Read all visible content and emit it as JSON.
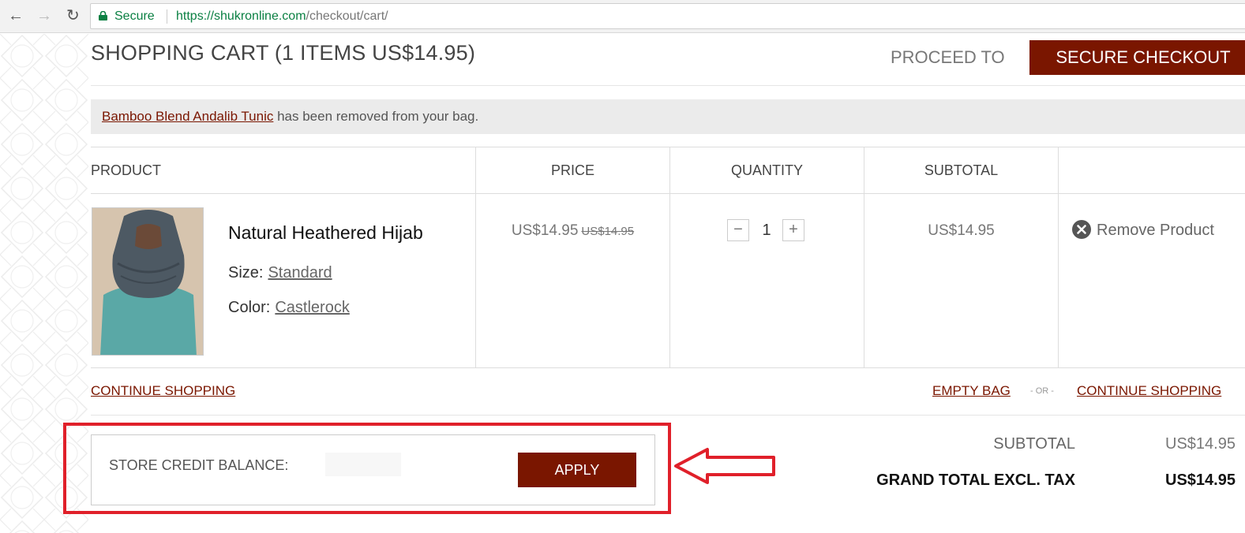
{
  "browser": {
    "secure_label": "Secure",
    "url_host": "https://shukronline.com",
    "url_path": "/checkout/cart/"
  },
  "header": {
    "title": "SHOPPING CART (1 ITEMS US$14.95)",
    "proceed_label": "PROCEED TO",
    "checkout_button": "SECURE CHECKOUT"
  },
  "notice": {
    "product_link": "Bamboo Blend Andalib Tunic",
    "message": " has been removed from your bag."
  },
  "table": {
    "headers": [
      "PRODUCT",
      "PRICE",
      "QUANTITY",
      "SUBTOTAL"
    ],
    "item": {
      "name": "Natural Heathered Hijab",
      "size_label": "Size:",
      "size_value": "Standard",
      "color_label": "Color:",
      "color_value": "Castlerock",
      "price": "US$14.95",
      "price_old": "US$14.95",
      "qty_minus": "−",
      "quantity": "1",
      "qty_plus": "+",
      "subtotal": "US$14.95",
      "remove_label": "Remove Product"
    }
  },
  "links": {
    "continue_left": "CONTINUE SHOPPING",
    "empty_bag": "EMPTY BAG",
    "or": "- OR -",
    "continue_right": "CONTINUE SHOPPING"
  },
  "store_credit": {
    "label": "STORE CREDIT BALANCE:",
    "apply_button": "APPLY"
  },
  "totals": {
    "subtotal_label": "SUBTOTAL",
    "subtotal_value": "US$14.95",
    "grand_label": "GRAND TOTAL EXCL. TAX",
    "grand_value": "US$14.95"
  },
  "colors": {
    "brand": "#7a1600",
    "highlight": "#e0202a",
    "secure": "#0b8043"
  },
  "icons": {
    "back": "arrow-left-icon",
    "forward": "arrow-right-icon",
    "reload": "reload-icon",
    "lock": "lock-icon",
    "remove": "remove-circle-icon",
    "annotation": "arrow-pointer-icon"
  }
}
